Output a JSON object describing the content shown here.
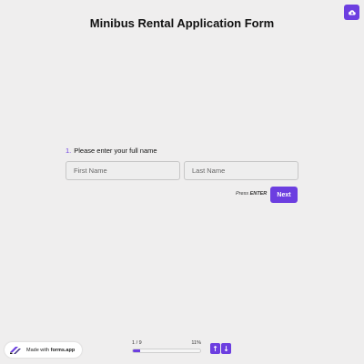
{
  "form": {
    "title": "Minibus Rental Application Form"
  },
  "question": {
    "number": "1.",
    "text": "Please enter your full name",
    "first_name_placeholder": "First Name",
    "last_name_placeholder": "Last Name",
    "first_name_value": "",
    "last_name_value": ""
  },
  "actions": {
    "press_prefix": "Press",
    "press_key": "ENTER",
    "next_label": "Next"
  },
  "footer": {
    "made_with": "Made with",
    "brand": "forms.app",
    "progress_count": "1 / 9",
    "progress_percent_label": "11%",
    "progress_fraction": 0.11
  },
  "icons": {
    "top_right": "cloud-icon",
    "up": "arrow-up-icon",
    "down": "arrow-down-icon"
  },
  "colors": {
    "accent": "#6c3ee0",
    "background": "#efeeee"
  }
}
